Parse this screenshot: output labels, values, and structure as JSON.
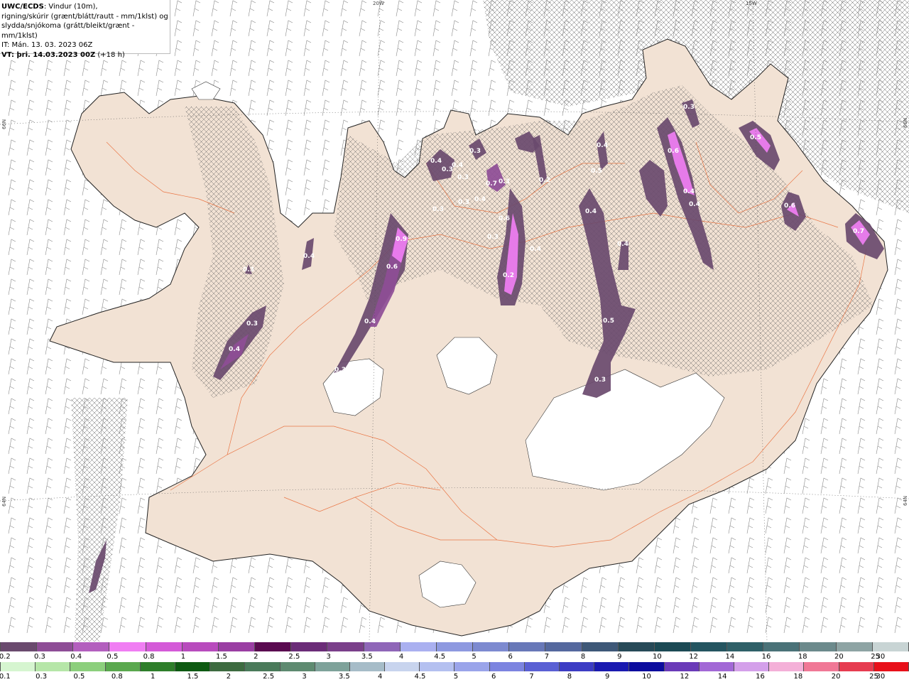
{
  "header": {
    "source": "UWC/ECDS",
    "line1_rest": ": Vindur (10m),",
    "line2": "rigning/skúrir (grænt/blátt/rautt - mm/1klst) og",
    "line3": "slydda/snjókoma (grátt/bleikt/grænt - mm/1klst)",
    "line4": "IT: Mán. 13. 03. 2023 06Z",
    "vt_label": "VT",
    "vt_value": ": þri. 14.03.2023 00Z",
    "vt_step": "(+18 h)"
  },
  "grid_labels": {
    "top_20w": "20W",
    "top_15w": "15W",
    "left_66n": "66N",
    "left_64n": "64N",
    "right_66n": "66N",
    "right_64n": "64N"
  },
  "precip_labels": [
    "0.4",
    "0.3",
    "0.4",
    "0.3",
    "0.4",
    "0.3",
    "0.4",
    "0.3",
    "0.9",
    "0.6",
    "0.4",
    "0.3",
    "0.3",
    "0.3",
    "0.4",
    "0.7",
    "0.3",
    "0.6",
    "0.2",
    "0.4",
    "0.3",
    "0.3",
    "0.2",
    "0.5",
    "0.4",
    "0.4",
    "0.5",
    "0.4",
    "0.3",
    "0.6",
    "0.4",
    "0.4",
    "0.3",
    "0.5",
    "0.6",
    "0.7"
  ],
  "colorbar_snow": {
    "ticks": [
      "0.2",
      "0.3",
      "0.4",
      "0.5",
      "0.8",
      "1",
      "1.5",
      "2",
      "2.5",
      "3",
      "3.5",
      "4",
      "4.5",
      "5",
      "6",
      "7",
      "8",
      "9",
      "10",
      "12",
      "14",
      "16",
      "18",
      "20",
      "25",
      "30"
    ],
    "colors": [
      "#6a4a6e",
      "#8e4d96",
      "#b35fbe",
      "#f07ef3",
      "#d45ad8",
      "#b84bbd",
      "#9a3ea3",
      "#5a0a50",
      "#6b2c78",
      "#7a3f8a",
      "#8f66b8",
      "#aab0f0",
      "#8e99e0",
      "#7d8ad0",
      "#6878b8",
      "#55689e",
      "#3e5878",
      "#274a58",
      "#1c4a55",
      "#245560",
      "#2f6068",
      "#4a7278",
      "#6c8a8c",
      "#8ea4a4",
      "#c8d4d4"
    ]
  },
  "colorbar_rain": {
    "ticks": [
      "0.1",
      "0.3",
      "0.5",
      "0.8",
      "1",
      "1.5",
      "2",
      "2.5",
      "3",
      "3.5",
      "4",
      "4.5",
      "5",
      "6",
      "7",
      "8",
      "9",
      "10",
      "12",
      "14",
      "16",
      "18",
      "20",
      "25",
      "30"
    ],
    "colors": [
      "#d6f5d0",
      "#b6e6a8",
      "#8ccf7c",
      "#5aa84e",
      "#2e7e2a",
      "#0e5a12",
      "#3d6b40",
      "#4a7a5a",
      "#5e8a70",
      "#7ea29a",
      "#a6bcc8",
      "#c8d4ee",
      "#b4c0f0",
      "#9aa4ea",
      "#7c84e0",
      "#5a60d4",
      "#3c3cc4",
      "#1a1ab0",
      "#0c0c9e",
      "#6a3ab8",
      "#a268d6",
      "#d4a0ea",
      "#f4b0d8",
      "#f07896",
      "#e63c50",
      "#e8101a"
    ]
  },
  "colors": {
    "land": "#f2e2d4",
    "coast": "#222222",
    "roads": "#e8632c",
    "ice": "#ffffff",
    "snow_low": "#6a4a6e",
    "snow_mid": "#8e4d96",
    "snow_high": "#f07ef3",
    "barb": "#888888"
  }
}
